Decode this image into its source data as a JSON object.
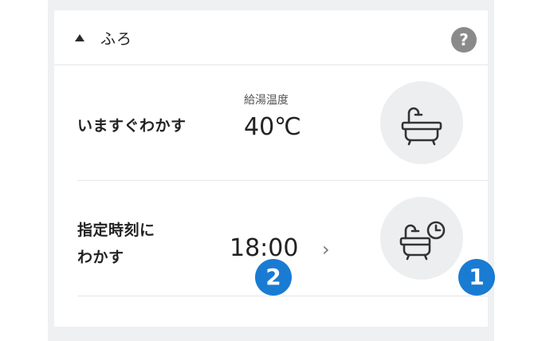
{
  "section": {
    "title": "ふろ",
    "help_label": "?"
  },
  "row_now": {
    "label": "いますぐわかす",
    "temp_caption": "給湯温度",
    "temp_value": "40℃",
    "icon": "bathtub-icon"
  },
  "row_timer": {
    "label_line1": "指定時刻に",
    "label_line2": "わかす",
    "time_value": "18:00",
    "chevron": "›",
    "icon": "bathtub-clock-icon"
  },
  "badges": {
    "one": "1",
    "two": "2"
  },
  "colors": {
    "badge": "#1a7bd3",
    "icon_bg": "#eceef0",
    "help_bg": "#8a8a8a"
  }
}
